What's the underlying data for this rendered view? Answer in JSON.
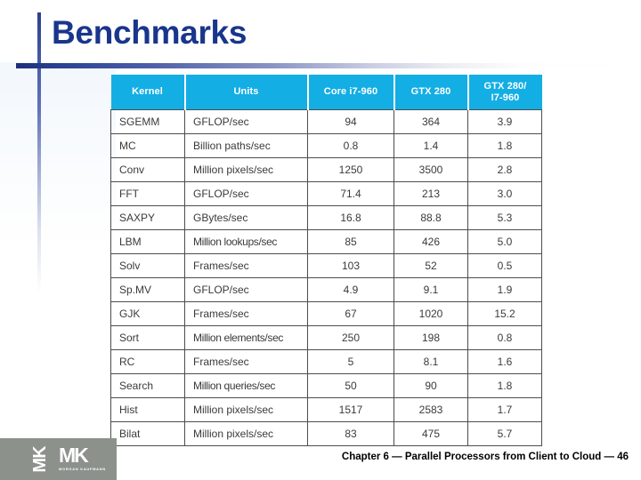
{
  "slide": {
    "title": "Benchmarks",
    "accent_navy": "#19368c",
    "accent_cyan": "#13aee4",
    "logo_gray": "#8c918c"
  },
  "table": {
    "headers": [
      "Kernel",
      "Units",
      "Core i7-960",
      "GTX 280",
      "GTX 280/\nI7-960"
    ],
    "header_lines": {
      "ratio_line1": "GTX 280/",
      "ratio_line2": "I7-960"
    },
    "rows": [
      {
        "kernel": "SGEMM",
        "units": "GFLOP/sec",
        "core_i7_960": "94",
        "gtx_280": "364",
        "ratio": "3.9"
      },
      {
        "kernel": "MC",
        "units": "Billion paths/sec",
        "core_i7_960": "0.8",
        "gtx_280": "1.4",
        "ratio": "1.8"
      },
      {
        "kernel": "Conv",
        "units": "Million pixels/sec",
        "core_i7_960": "1250",
        "gtx_280": "3500",
        "ratio": "2.8"
      },
      {
        "kernel": "FFT",
        "units": "GFLOP/sec",
        "core_i7_960": "71.4",
        "gtx_280": "213",
        "ratio": "3.0"
      },
      {
        "kernel": "SAXPY",
        "units": "GBytes/sec",
        "core_i7_960": "16.8",
        "gtx_280": "88.8",
        "ratio": "5.3"
      },
      {
        "kernel": "LBM",
        "units": "Million lookups/sec",
        "core_i7_960": "85",
        "gtx_280": "426",
        "ratio": "5.0"
      },
      {
        "kernel": "Solv",
        "units": "Frames/sec",
        "core_i7_960": "103",
        "gtx_280": "52",
        "ratio": "0.5"
      },
      {
        "kernel": "Sp.MV",
        "units": "GFLOP/sec",
        "core_i7_960": "4.9",
        "gtx_280": "9.1",
        "ratio": "1.9"
      },
      {
        "kernel": "GJK",
        "units": "Frames/sec",
        "core_i7_960": "67",
        "gtx_280": "1020",
        "ratio": "15.2"
      },
      {
        "kernel": "Sort",
        "units": "Million elements/sec",
        "core_i7_960": "250",
        "gtx_280": "198",
        "ratio": "0.8"
      },
      {
        "kernel": "RC",
        "units": "Frames/sec",
        "core_i7_960": "5",
        "gtx_280": "8.1",
        "ratio": "1.6"
      },
      {
        "kernel": "Search",
        "units": "Million queries/sec",
        "core_i7_960": "50",
        "gtx_280": "90",
        "ratio": "1.8"
      },
      {
        "kernel": "Hist",
        "units": "Million pixels/sec",
        "core_i7_960": "1517",
        "gtx_280": "2583",
        "ratio": "1.7"
      },
      {
        "kernel": "Bilat",
        "units": "Million pixels/sec",
        "core_i7_960": "83",
        "gtx_280": "475",
        "ratio": "5.7"
      }
    ]
  },
  "footer": {
    "logo_rotated": "MK",
    "logo_main": "MK",
    "logo_sub": "MORGAN KAUFMANN",
    "text": "Chapter 6 — Parallel Processors from Client to Cloud — 46"
  }
}
